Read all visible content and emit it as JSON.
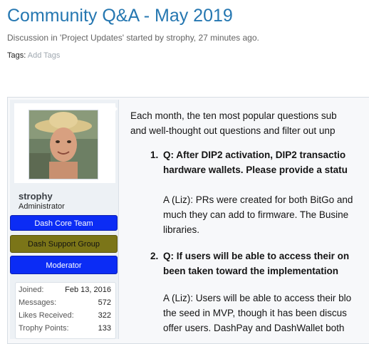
{
  "thread": {
    "title": "Community Q&A - May 2019",
    "meta": "Discussion in 'Project Updates' started by strophy, 27 minutes ago.",
    "tags_label": "Tags:",
    "add_tags": "Add Tags"
  },
  "author": {
    "username": "strophy",
    "user_title": "Administrator",
    "banners": [
      "Dash Core Team",
      "Dash Support Group",
      "Moderator"
    ],
    "stats": [
      {
        "label": "Joined:",
        "value": "Feb 13, 2016"
      },
      {
        "label": "Messages:",
        "value": "572"
      },
      {
        "label": "Likes Received:",
        "value": "322"
      },
      {
        "label": "Trophy Points:",
        "value": "133"
      }
    ]
  },
  "body": {
    "intro_1": "Each month, the ten most popular questions sub",
    "intro_2": "and well-thought out questions and filter out unp",
    "items": [
      {
        "number": "1.",
        "q1": "Q: After DIP2 activation, DIP2 transactio",
        "q2": "hardware wallets. Please provide a statu",
        "a1": "A (Liz): PRs were created for both BitGo and",
        "a2": "much they can add to firmware. The Busine",
        "a3": "libraries."
      },
      {
        "number": "2.",
        "q1": "Q: If users will be able to access their on",
        "q2": "been taken toward the implementation",
        "a1": "A (Liz): Users will be able to access their blo",
        "a2": "the seed in MVP, though it has been discus",
        "a3": "offer users. DashPay and DashWallet both"
      }
    ]
  }
}
